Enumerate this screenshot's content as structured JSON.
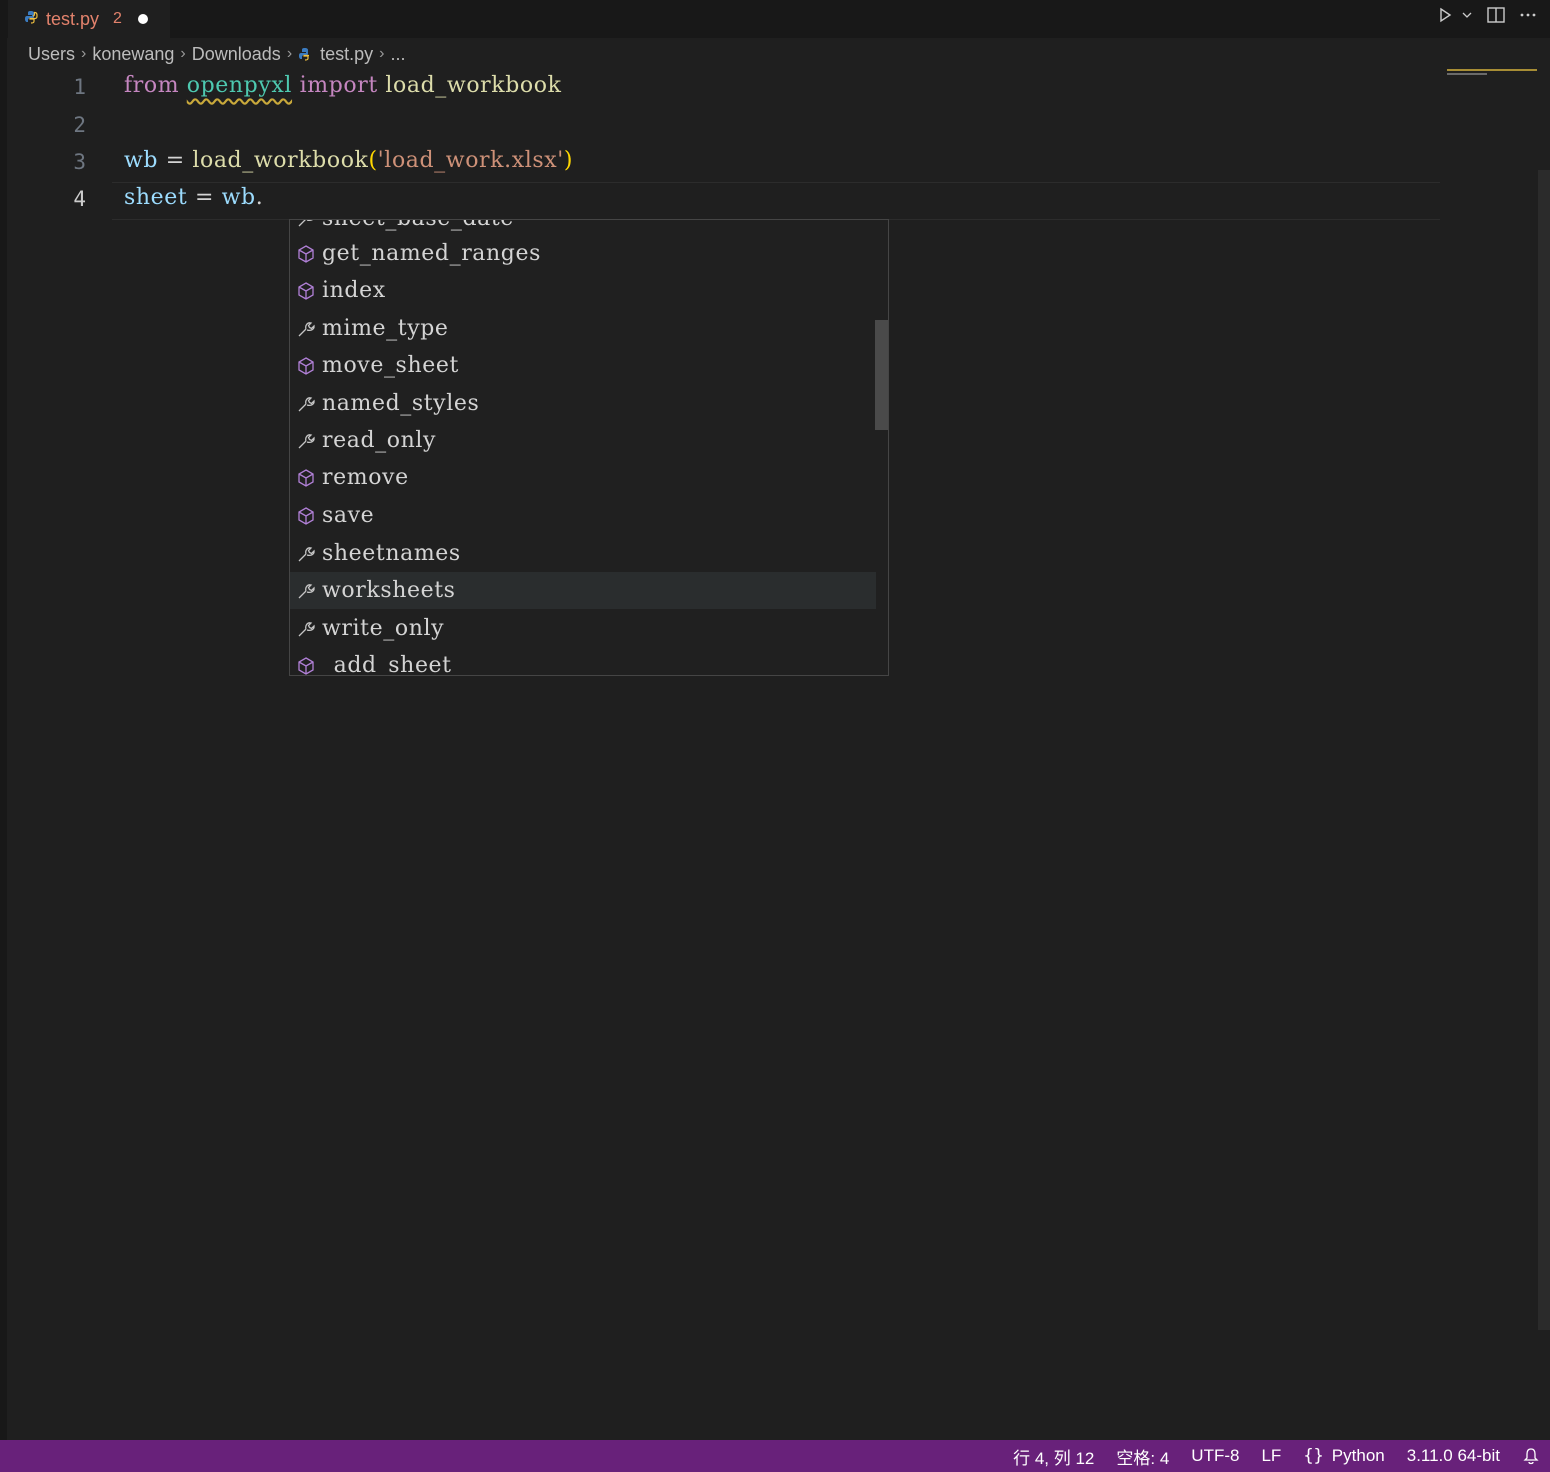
{
  "tab": {
    "filename": "test.py",
    "problem_count": "2",
    "dirty": true
  },
  "breadcrumb": [
    "Users",
    "konewang",
    "Downloads",
    "test.py",
    "..."
  ],
  "editor": {
    "line_numbers": [
      "1",
      "2",
      "3",
      "4"
    ],
    "active_line": 4,
    "line1": {
      "from": "from",
      "module": "openpyxl",
      "import": "import",
      "name": "load_workbook"
    },
    "line3": {
      "var": "wb",
      "eq": "=",
      "fn": "load_workbook",
      "open": "(",
      "arg": "'load_work.xlsx'",
      "close": ")"
    },
    "line4": {
      "var": "sheet",
      "eq": "=",
      "obj": "wb",
      "dot": "."
    }
  },
  "suggestions": [
    {
      "label": "sheet_base_date",
      "kind": "property",
      "icon": "wrench-icon"
    },
    {
      "label": "get_named_ranges",
      "kind": "method",
      "icon": "cube-icon"
    },
    {
      "label": "index",
      "kind": "method",
      "icon": "cube-icon"
    },
    {
      "label": "mime_type",
      "kind": "property",
      "icon": "wrench-icon"
    },
    {
      "label": "move_sheet",
      "kind": "method",
      "icon": "cube-icon"
    },
    {
      "label": "named_styles",
      "kind": "property",
      "icon": "wrench-icon"
    },
    {
      "label": "read_only",
      "kind": "property",
      "icon": "wrench-icon"
    },
    {
      "label": "remove",
      "kind": "method",
      "icon": "cube-icon"
    },
    {
      "label": "save",
      "kind": "method",
      "icon": "cube-icon"
    },
    {
      "label": "sheetnames",
      "kind": "property",
      "icon": "wrench-icon"
    },
    {
      "label": "worksheets",
      "kind": "property",
      "icon": "wrench-icon",
      "selected": true
    },
    {
      "label": "write_only",
      "kind": "property",
      "icon": "wrench-icon"
    },
    {
      "label": "_add_sheet",
      "kind": "method",
      "icon": "cube-icon"
    }
  ],
  "statusbar": {
    "position": "行 4, 列 12",
    "spaces": "空格: 4",
    "encoding": "UTF-8",
    "eol": "LF",
    "language": "Python",
    "interpreter": "3.11.0 64-bit"
  },
  "colors": {
    "statusbar": "#68217a",
    "keyword": "#c586c0",
    "module": "#4ec9b0",
    "function": "#dcdcaa",
    "variable": "#9cdcfe",
    "string": "#ce9178"
  }
}
